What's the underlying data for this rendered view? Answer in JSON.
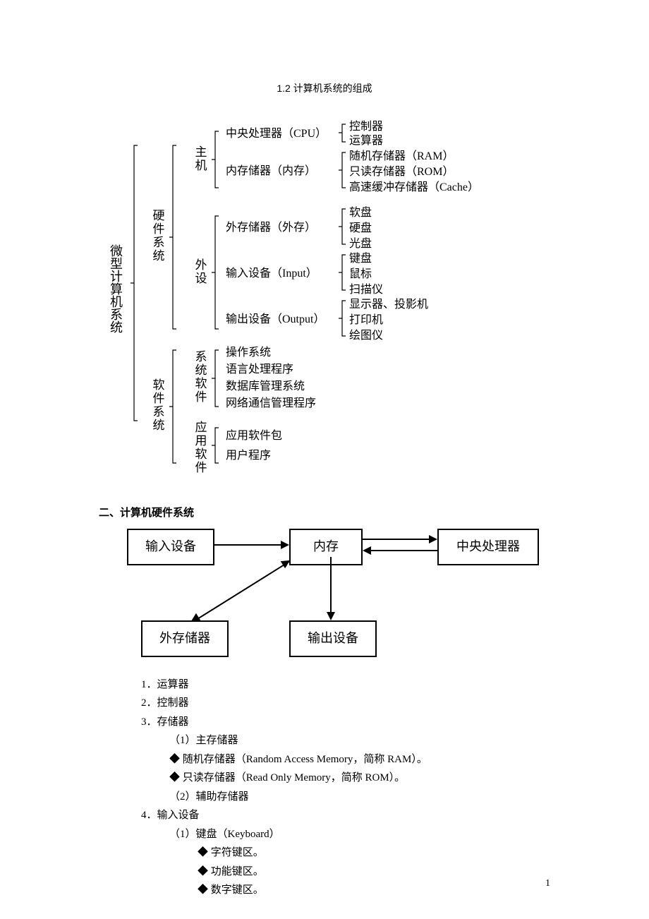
{
  "title": "1.2  计算机系统的组成",
  "tree": {
    "root": "微型计算机系统",
    "hw": "硬件系统",
    "sw": "软件系统",
    "host": "主机",
    "periph": "外设",
    "sys_sw": "系统软件",
    "app_sw": "应用软件",
    "cpu": "中央处理器（CPU）",
    "cpu_a": "控制器",
    "cpu_b": "运算器",
    "mem": "内存储器（内存）",
    "mem_a": "随机存储器（RAM）",
    "mem_b": "只读存储器（ROM）",
    "mem_c": "高速缓冲存储器（Cache）",
    "ext": "外存储器（外存）",
    "ext_a": "软盘",
    "ext_b": "硬盘",
    "ext_c": "光盘",
    "inp": "输入设备（Input）",
    "inp_a": "键盘",
    "inp_b": "鼠标",
    "inp_c": "扫描仪",
    "out": "输出设备（Output）",
    "out_a": "显示器、投影机",
    "out_b": "打印机",
    "out_c": "绘图仪",
    "sys_a": "操作系统",
    "sys_b": "语言处理程序",
    "sys_c": "数据库管理系统",
    "sys_d": "网络通信管理程序",
    "app_a": "应用软件包",
    "app_b": "用户程序"
  },
  "section2": "二、计算机硬件系统",
  "flow": {
    "input_dev": "输入设备",
    "memory": "内存",
    "cpu": "中央处理器",
    "ext_storage": "外存储器",
    "output_dev": "输出设备"
  },
  "list": {
    "l1": "1．运算器",
    "l2": "2．控制器",
    "l3": "3．存储器",
    "l3_1": "（1）主存储器",
    "l3_1a": "◆ 随机存储器（Random Access Memory，简称 RAM）。",
    "l3_1b": "◆ 只读存储器（Read Only Memory，简称 ROM）。",
    "l3_2": "（2）辅助存储器",
    "l4": "4．输入设备",
    "l4_1": "（1）键盘（Keyboard）",
    "l4_1a": "◆ 字符键区。",
    "l4_1b": "◆ 功能键区。",
    "l4_1c": "◆ 数字键区。"
  },
  "page_num": "1"
}
